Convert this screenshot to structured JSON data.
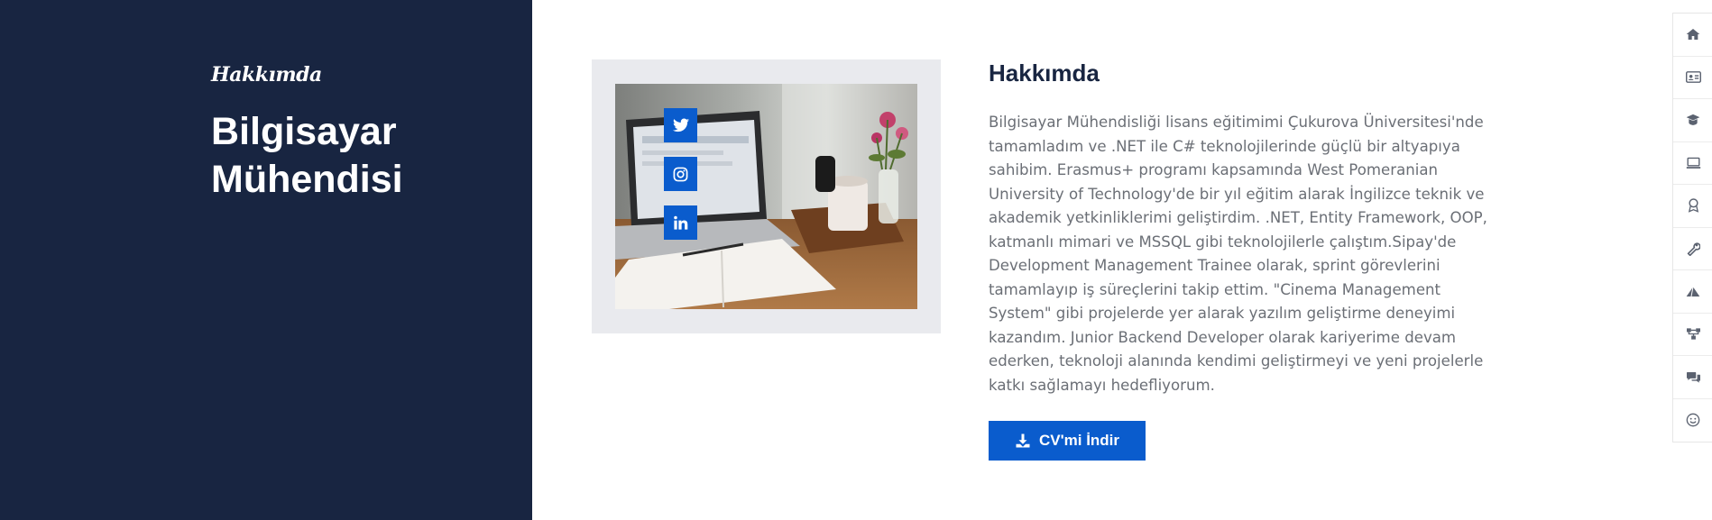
{
  "hero": {
    "eyebrow": "Hakkımda",
    "title": "Bilgisayar Mühendisi"
  },
  "about": {
    "title": "Hakkımda",
    "text": "Bilgisayar Mühendisliği lisans eğitimimi Çukurova Üniversitesi'nde tamamladım ve .NET ile C# teknolojilerinde güçlü bir altyapıya sahibim. Erasmus+ programı kapsamında West Pomeranian University of Technology'de bir yıl eğitim alarak İngilizce teknik ve akademik yetkinliklerimi geliştirdim. .NET, Entity Framework, OOP, katmanlı mimari ve MSSQL gibi teknolojilerle çalıştım.Sipay'de Development Management Trainee olarak, sprint görevlerini tamamlayıp iş süreçlerini takip ettim. \"Cinema Management System\" gibi projelerde yer alarak yazılım geliştirme deneyimi kazandım. Junior Backend Developer olarak kariyerime devam ederken, teknoloji alanında kendimi geliştirmeyi ve yeni projelerle katkı sağlamayı hedefliyorum.",
    "cv_button": "CV'mi İndir"
  },
  "social": [
    {
      "icon": "twitter-icon"
    },
    {
      "icon": "instagram-icon"
    },
    {
      "icon": "linkedin-icon"
    }
  ],
  "side_nav": [
    {
      "icon": "home-icon"
    },
    {
      "icon": "id-card-icon"
    },
    {
      "icon": "graduation-cap-icon"
    },
    {
      "icon": "laptop-icon"
    },
    {
      "icon": "award-icon"
    },
    {
      "icon": "tools-icon"
    },
    {
      "icon": "paper-plane-icon"
    },
    {
      "icon": "network-icon"
    },
    {
      "icon": "comments-icon"
    },
    {
      "icon": "smile-icon"
    }
  ],
  "colors": {
    "navy": "#182541",
    "accent": "#0a5ccd",
    "text_gray": "#6b6f76",
    "frame": "#e9eaee"
  }
}
